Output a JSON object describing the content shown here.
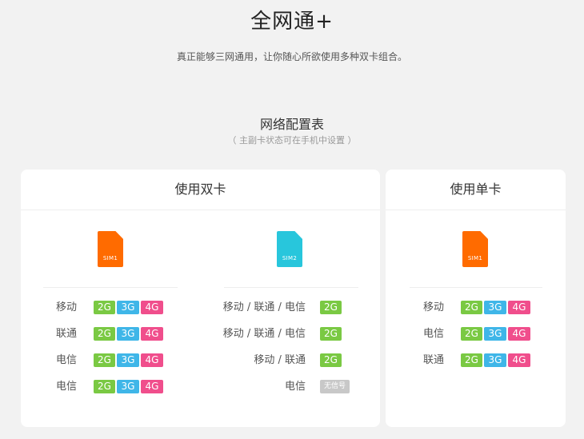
{
  "header": {
    "title": "全网通+",
    "subtitle": "真正能够三网通用，让你随心所欲使用多种双卡组合。"
  },
  "section": {
    "title": "网络配置表",
    "note": "（ 主副卡状态可在手机中设置 ）"
  },
  "colors": {
    "orange": "#ff6b00",
    "cyan": "#28c6dc",
    "g2": "#7ac943",
    "g3": "#3fb6e8",
    "g4": "#f04e8c",
    "no_signal": "#c8c8c8"
  },
  "dual": {
    "title": "使用双卡",
    "sim1": "SIM1",
    "sim2": "SIM2",
    "sim1_rows": [
      {
        "label": "移动",
        "b1": "2G",
        "b2": "3G",
        "b3": "4G"
      },
      {
        "label": "联通",
        "b1": "2G",
        "b2": "3G",
        "b3": "4G"
      },
      {
        "label": "电信",
        "b1": "2G",
        "b2": "3G",
        "b3": "4G"
      },
      {
        "label": "电信",
        "b1": "2G",
        "b2": "3G",
        "b3": "4G"
      }
    ],
    "sim2_rows": [
      {
        "label": "移动 / 联通 / 电信",
        "badge": "2G"
      },
      {
        "label": "移动 / 联通 / 电信",
        "badge": "2G"
      },
      {
        "label": "移动 / 联通",
        "badge": "2G"
      },
      {
        "label": "电信",
        "badge": "无信号"
      }
    ]
  },
  "single": {
    "title": "使用单卡",
    "sim": "SIM1",
    "rows": [
      {
        "label": "移动",
        "b1": "2G",
        "b2": "3G",
        "b3": "4G"
      },
      {
        "label": "电信",
        "b1": "2G",
        "b2": "3G",
        "b3": "4G"
      },
      {
        "label": "联通",
        "b1": "2G",
        "b2": "3G",
        "b3": "4G"
      }
    ]
  }
}
